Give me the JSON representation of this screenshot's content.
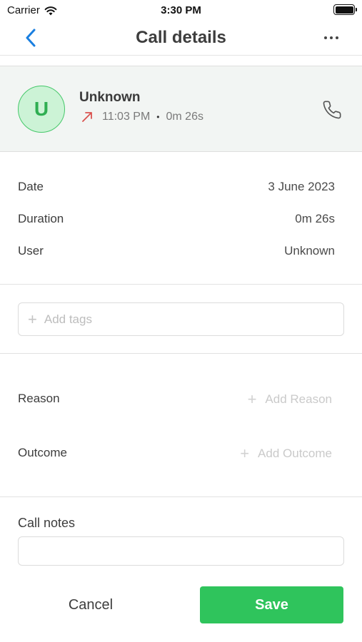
{
  "status_bar": {
    "carrier": "Carrier",
    "time": "3:30 PM",
    "icons": [
      "wifi-icon",
      "battery-icon"
    ]
  },
  "nav": {
    "title": "Call details",
    "back_icon": "chevron-left-icon",
    "more_icon": "more-horizontal-icon"
  },
  "contact": {
    "avatar_initial": "U",
    "name": "Unknown",
    "call_direction_icon": "outgoing-arrow-icon",
    "time": "11:03 PM",
    "separator": "•",
    "duration": "0m 26s",
    "call_icon": "phone-icon"
  },
  "details": [
    {
      "label": "Date",
      "value": "3 June 2023"
    },
    {
      "label": "Duration",
      "value": "0m 26s"
    },
    {
      "label": "User",
      "value": "Unknown"
    }
  ],
  "tags": {
    "plus": "+",
    "placeholder": "Add tags"
  },
  "reason": {
    "label": "Reason",
    "plus": "+",
    "action": "Add Reason"
  },
  "outcome": {
    "label": "Outcome",
    "plus": "+",
    "action": "Add Outcome"
  },
  "notes": {
    "label": "Call notes",
    "value": ""
  },
  "actions": {
    "cancel": "Cancel",
    "save": "Save"
  },
  "colors": {
    "accent": "#2fc45c",
    "link": "#1a7fe0",
    "outgoing": "#d9534f",
    "card_bg": "#f2f5f3"
  }
}
